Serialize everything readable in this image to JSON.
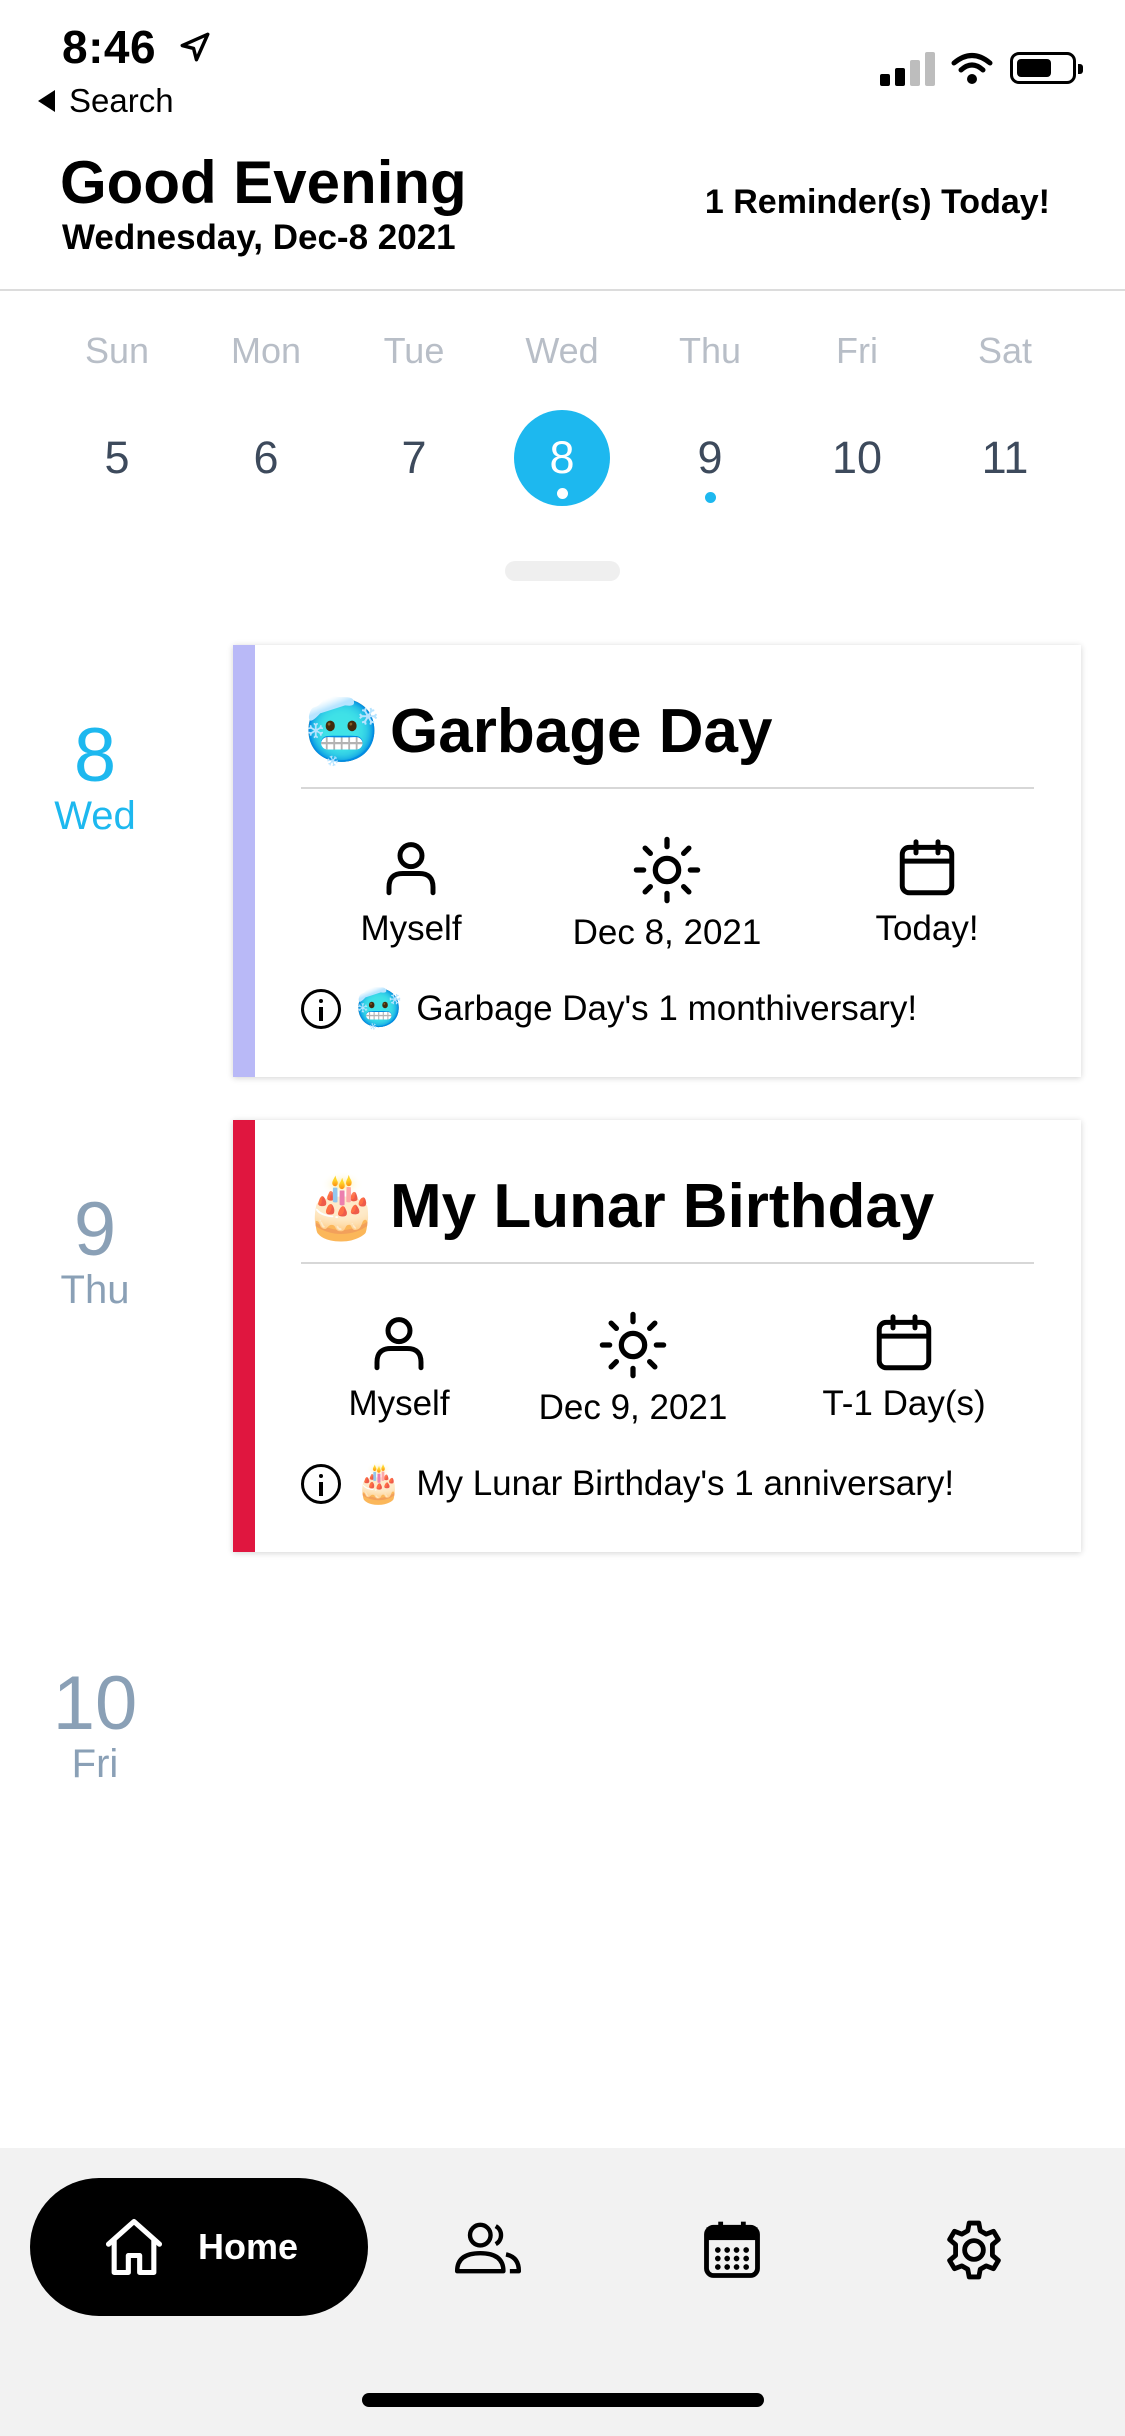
{
  "status_bar": {
    "time": "8:46",
    "back_label": "Search"
  },
  "header": {
    "greeting": "Good Evening",
    "date": "Wednesday, Dec-8 2021",
    "reminders": "1 Reminder(s) Today!"
  },
  "week": {
    "days": [
      {
        "name": "Sun",
        "num": "5",
        "selected": false,
        "has_event": false
      },
      {
        "name": "Mon",
        "num": "6",
        "selected": false,
        "has_event": false
      },
      {
        "name": "Tue",
        "num": "7",
        "selected": false,
        "has_event": false
      },
      {
        "name": "Wed",
        "num": "8",
        "selected": true,
        "has_event": true
      },
      {
        "name": "Thu",
        "num": "9",
        "selected": false,
        "has_event": true
      },
      {
        "name": "Fri",
        "num": "10",
        "selected": false,
        "has_event": false
      },
      {
        "name": "Sat",
        "num": "11",
        "selected": false,
        "has_event": false
      }
    ],
    "accent_color": "#1db8ef"
  },
  "timeline": {
    "days": [
      {
        "num": "8",
        "weekday": "Wed"
      },
      {
        "num": "9",
        "weekday": "Thu"
      },
      {
        "num": "10",
        "weekday": "Fri"
      }
    ],
    "events": [
      {
        "emoji": "🥶",
        "title": "Garbage Day",
        "person": "Myself",
        "date": "Dec 8, 2021",
        "countdown": "Today!",
        "note_emoji": "🥶",
        "note": "Garbage Day's 1 monthiversary!",
        "color": "#b9b9f7"
      },
      {
        "emoji": "🎂",
        "title": "My Lunar Birthday",
        "person": "Myself",
        "date": "Dec 9, 2021",
        "countdown": "T-1 Day(s)",
        "note_emoji": "🎂",
        "note": "My Lunar Birthday's 1 anniversary!",
        "color": "#e0163f"
      }
    ]
  },
  "bottom_nav": {
    "home_label": "Home",
    "icons": [
      "home-icon",
      "people-icon",
      "calendar-icon",
      "gear-icon"
    ]
  }
}
